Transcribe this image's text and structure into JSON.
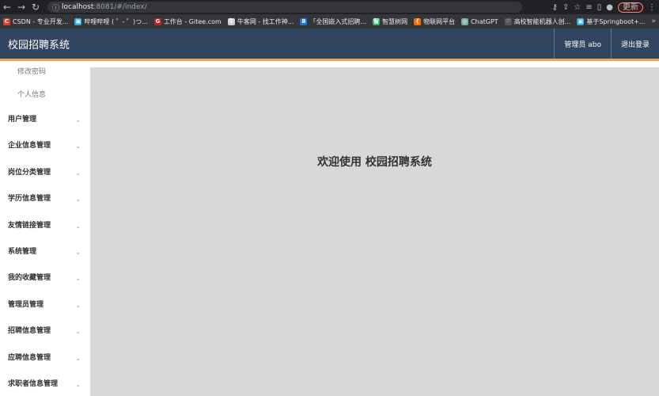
{
  "browser": {
    "url_host": "localhost",
    "url_rest": ":8081/#/index/",
    "update_label": "更新",
    "bookmarks": [
      {
        "label": "CSDN - 专业开发...",
        "color": "#e03c31",
        "glyph": "C"
      },
      {
        "label": "哔哩哔哩 ( ゜- ゜)つ...",
        "color": "#23ade5",
        "glyph": "▣"
      },
      {
        "label": "工作台 - Gitee.com",
        "color": "#c71d23",
        "glyph": "G"
      },
      {
        "label": "牛客网 - 找工作神...",
        "color": "#cccccc",
        "glyph": "牛"
      },
      {
        "label": "「全国嵌入式招聘...",
        "color": "#1a73e8",
        "glyph": "B"
      },
      {
        "label": "智慧树网",
        "color": "#2bb673",
        "glyph": "智"
      },
      {
        "label": "物联网平台",
        "color": "#ff6a00",
        "glyph": "{"
      },
      {
        "label": "ChatGPT",
        "color": "#74aa9c",
        "glyph": "◎"
      },
      {
        "label": "高校智能机器人创...",
        "color": "#555555",
        "glyph": "♡"
      },
      {
        "label": "基于Springboot+...",
        "color": "#23ade5",
        "glyph": "▣"
      }
    ],
    "more": "»"
  },
  "header": {
    "title": "校园招聘系统",
    "admin_label": "管理员 abo",
    "logout_label": "退出登录"
  },
  "sidebar": {
    "sub_items": [
      "修改密码",
      "个人信息"
    ],
    "items": [
      "用户管理",
      "企业信息管理",
      "岗位分类管理",
      "学历信息管理",
      "友情链接管理",
      "系统管理",
      "我的收藏管理",
      "管理员管理",
      "招聘信息管理",
      "应聘信息管理",
      "求职者信息管理"
    ]
  },
  "main": {
    "welcome": "欢迎使用 校园招聘系统"
  }
}
